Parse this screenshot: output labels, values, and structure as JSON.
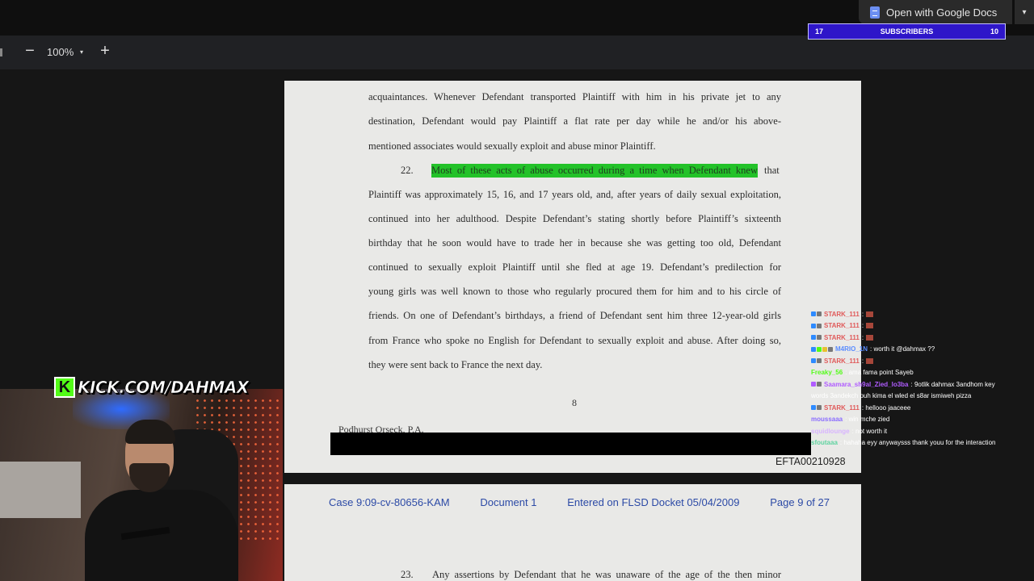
{
  "toolbar": {
    "open_with_label": "Open with Google Docs",
    "dropdown_caret": "▾",
    "zoom_out": "−",
    "zoom_value": "100%",
    "zoom_caret": "▾",
    "zoom_in": "+"
  },
  "subscribers": {
    "left_count": "17",
    "label": "SUBSCRIBERS",
    "right_count": "10"
  },
  "page1": {
    "lines": [
      "acquaintances.  Whenever Defendant transported Plaintiff with him in his private jet to any",
      "destination, Defendant would pay Plaintiff a flat rate per day while he and/or his above-",
      "mentioned associates would sexually exploit and abuse minor Plaintiff.",
      "22.",
      "Most of these acts of abuse occurred during a time when Defendant knew",
      "that",
      "Plaintiff was approximately 15, 16, and 17 years old, and, after years of daily sexual exploitation,",
      "continued into her adulthood.  Despite Defendant’s stating shortly before Plaintiff’s sixteenth",
      "birthday that he soon would have to trade her in because she was getting too old, Defendant",
      "continued to sexually exploit Plaintiff until she fled at age 19.  Defendant’s predilection for",
      "young girls was well known to those who regularly procured them for him and to his circle of",
      "friends.  On one of Defendant’s birthdays, a friend of Defendant sent him three 12-year-old girls",
      "from France who spoke no English for Defendant to sexually exploit and abuse.  After doing so,",
      "they were sent back to France the next day."
    ],
    "page_number": "8",
    "firm": "Podhurst Orseck, P.A.",
    "bates": "EFTA00210928"
  },
  "page2": {
    "case": "Case 9:09-cv-80656-KAM",
    "document": "Document 1",
    "entered": "Entered on FLSD Docket 05/04/2009",
    "page": "Page 9 of 27",
    "para_num": "23.",
    "para_text": "Any assertions by Defendant that he was unaware of the age of the then minor"
  },
  "stream": {
    "kick_logo": "K",
    "kick_url": "KICK.COM/DAHMAX"
  },
  "chat": [
    {
      "user": "STARK_111",
      "color": "#e05a5a",
      "text": ":",
      "emote": true,
      "badges": [
        "#2e8bff",
        "#777"
      ]
    },
    {
      "user": "STARK_111",
      "color": "#e05a5a",
      "text": ":",
      "emote": true,
      "badges": [
        "#2e8bff",
        "#777"
      ]
    },
    {
      "user": "STARK_111",
      "color": "#e05a5a",
      "text": ":",
      "emote": true,
      "badges": [
        "#2e8bff",
        "#777"
      ]
    },
    {
      "user": "M4RIO_1N",
      "color": "#5a8cff",
      "text": ": worth it @dahmax ??",
      "emote": false,
      "badges": [
        "#2e8bff",
        "#53fc18",
        "#e8c12f",
        "#777"
      ]
    },
    {
      "user": "STARK_111",
      "color": "#e05a5a",
      "text": ":",
      "emote": true,
      "badges": [
        "#2e8bff",
        "#777"
      ]
    },
    {
      "user": "Freaky_56",
      "color": "#53fc18",
      "text": ": ama fama point Sayeb",
      "emote": false,
      "badges": []
    },
    {
      "user": "Saamara_sh9al_Zied_lo3ba",
      "color": "#b05cff",
      "text": ": 9otlik dahmax 3andhom key",
      "emote": false,
      "badges": [
        "#b05cff",
        "#777"
      ]
    },
    {
      "user": "",
      "color": "#fff",
      "text": "words 3andekch puh kima el wled el s8ar ismiweh pizza",
      "emote": false,
      "badges": []
    },
    {
      "user": "STARK_111",
      "color": "#e05a5a",
      "text": ": hellooo jaaceee",
      "emote": false,
      "badges": [
        "#2e8bff",
        "#777"
      ]
    },
    {
      "user": "moussaaa",
      "color": "#8a6cff",
      "text": ": win mche zied",
      "emote": false,
      "badges": []
    },
    {
      "user": "squidlounge",
      "color": "#d8b4ff",
      "text": ": not worth it",
      "emote": false,
      "badges": []
    },
    {
      "user": "sfoutaaa",
      "color": "#5fd3a0",
      "text": ": hahaha eyy anywaysss thank youu for the interaction",
      "emote": false,
      "badges": []
    }
  ]
}
